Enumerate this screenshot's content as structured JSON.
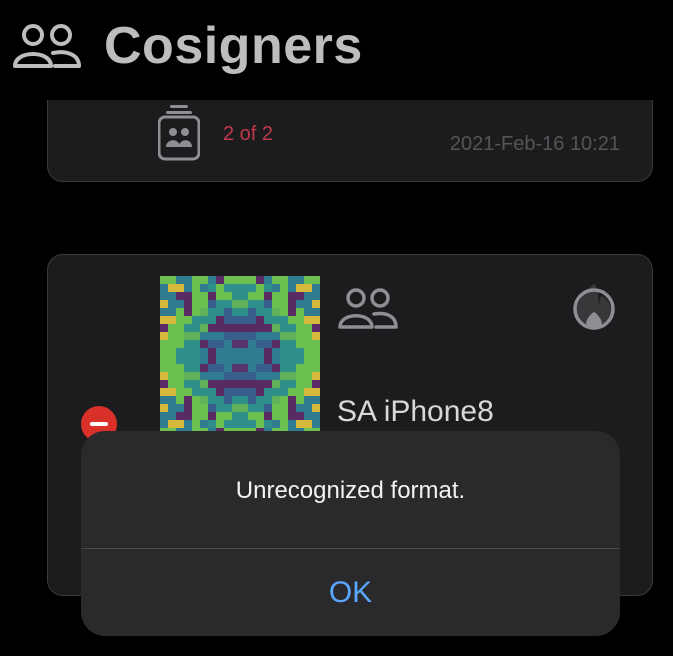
{
  "header": {
    "title": "Cosigners",
    "icon": "people-group-icon"
  },
  "cards": [
    {
      "icon": "signer-stack-icon",
      "count_text": "2 of 2",
      "date": "2021-Feb-16 10:21"
    },
    {
      "image": "qr-code-image",
      "type_icon": "people-group-icon",
      "status_icon": "flame-icon",
      "device_name": "SA iPhone8"
    }
  ],
  "alert": {
    "message": "Unrecognized format.",
    "ok_label": "OK"
  },
  "colors": {
    "background": "#000000",
    "card": "#1c1c1e",
    "title": "#bdbdbd",
    "count": "#c0394b",
    "date": "#555558",
    "alert_bg": "#2a2a2c",
    "ok_button": "#5aa7ff",
    "delete": "#d9312a"
  }
}
